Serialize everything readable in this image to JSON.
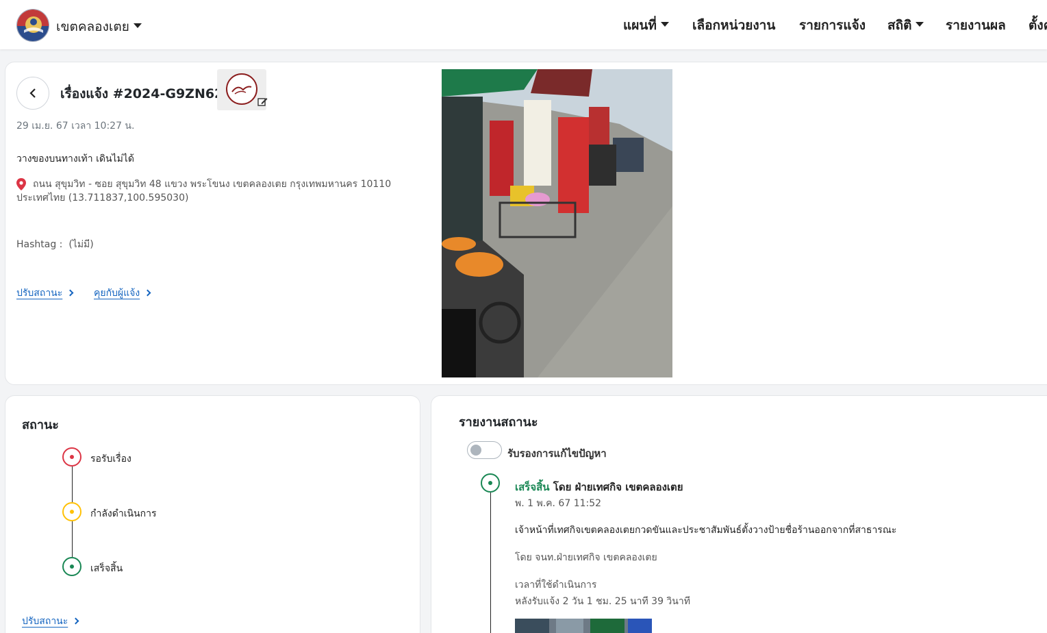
{
  "navbar": {
    "brand": "เขตคลองเตย",
    "items": [
      {
        "label": "แผนที่",
        "dropdown": true
      },
      {
        "label": "เลือกหน่วยงาน",
        "dropdown": false
      },
      {
        "label": "รายการแจ้ง",
        "dropdown": false
      },
      {
        "label": "สถิติ",
        "dropdown": true
      },
      {
        "label": "รายงานผล",
        "dropdown": false
      },
      {
        "label": "ตั้งค่า",
        "dropdown": false
      }
    ]
  },
  "ticket": {
    "title": "เรื่องแจ้ง #2024-G9ZN62",
    "datetime": "29 เม.ย. 67 เวลา 10:27 น.",
    "description": "วางของบนทางเท้า เดินไม่ได้",
    "address": "ถนน สุขุมวิท - ซอย สุขุมวิท 48 แขวง พระโขนง เขตคลองเตย กรุงเทพมหานคร 10110 ประเทศไทย (13.711837,100.595030)",
    "hashtag_label": "Hashtag :",
    "hashtag_value": "(ไม่มี)",
    "links": {
      "update_status": "ปรับสถานะ",
      "chat_reporter": "คุยกับผู้แจ้ง"
    }
  },
  "status": {
    "title": "สถานะ",
    "steps": [
      {
        "label": "รอรับเรื่อง",
        "color": "#dc3545"
      },
      {
        "label": "กำลังดำเนินการ",
        "color": "#ffc107"
      },
      {
        "label": "เสร็จสิ้น",
        "color": "#198754"
      }
    ],
    "update_link": "ปรับสถานะ"
  },
  "report": {
    "title": "รายงานสถานะ",
    "toggle_label": "รับรองการแก้ไขปัญหา",
    "entry": {
      "status": "เสร็จสิ้น",
      "by": "โดย ฝ่ายเทศกิจ เขตคลองเตย",
      "datetime": "พ. 1 พ.ค. 67 11:52",
      "message": "เจ้าหน้าที่เทศกิจเขตคลองเตยกวดขันและประชาสัมพันธ์ตั้งวางป้ายชื่อร้านออกจากที่สาธารณะ",
      "officer": "โดย จนท.ฝ่ายเทศกิจ เขตคลองเตย",
      "duration_label": "เวลาที่ใช้ดำเนินการ",
      "duration_value": "หลังรับแจ้ง 2 วัน 1 ชม. 25 นาที 39 วินาที"
    }
  },
  "colors": {
    "green": "#198754",
    "link": "#1565c0"
  }
}
